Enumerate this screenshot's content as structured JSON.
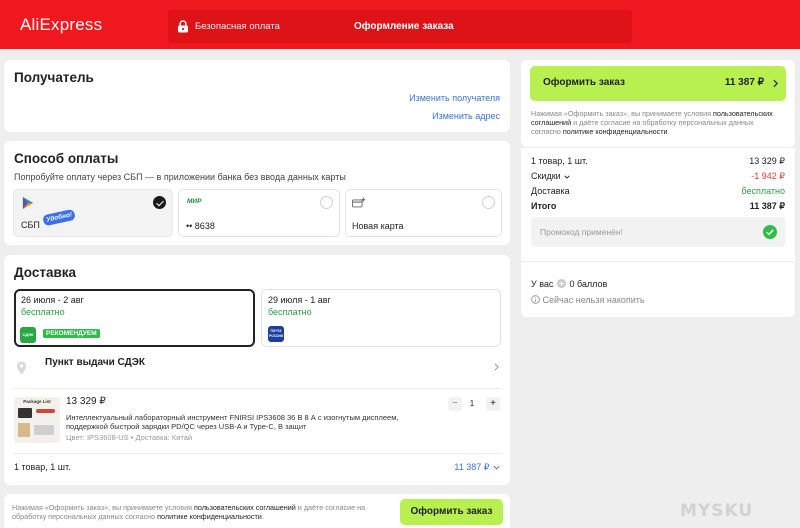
{
  "header": {
    "logo": "AliExpress",
    "secure_label": "Безопасная оплата",
    "title": "Оформление заказа"
  },
  "recipient": {
    "title": "Получатель",
    "change_recipient": "Изменить получателя",
    "change_address": "Изменить адрес"
  },
  "payment": {
    "title": "Способ оплаты",
    "subtitle": "Попробуйте оплату через СБП — в приложении банка без ввода данных карты",
    "options": [
      {
        "label": "СБП",
        "badge": "Удобно!",
        "selected": true
      },
      {
        "brand": "МИР",
        "label": "•• 8638",
        "selected": false
      },
      {
        "label": "Новая карта",
        "selected": false
      }
    ]
  },
  "delivery": {
    "title": "Доставка",
    "options": [
      {
        "dates": "26 июля - 2 авг",
        "price": "бесплатно",
        "carrier": "СДЭК",
        "badge": "РЕКОМЕНДУЕМ",
        "selected": true
      },
      {
        "dates": "29 июля - 1 авг",
        "price": "бесплатно",
        "carrier": "ПОЧТА РОССИИ",
        "selected": false
      }
    ],
    "pickup": "Пункт выдачи СДЭК"
  },
  "product": {
    "price": "13 329 ₽",
    "name_line1": "Интеллектуальный лабораторный инструмент FNIRSI IPS3608 36 В 8 А с изогнутым дисплеем,",
    "name_line2": "поддержкой быстрой зарядки PD/QC через USB-A и Type-C, В защит",
    "meta": "Цвет: IPS3608-US • Доставка: Китай",
    "image_caption": "Package List",
    "quantity": "1",
    "minus": "−",
    "plus": "+"
  },
  "items_footer": {
    "count": "1 товар, 1 шт.",
    "total": "11 387 ₽"
  },
  "bottom_bar": {
    "text_part1": "Нажимая «Оформить заказ», вы принимаете условия ",
    "text_link1": "пользовательских соглашений",
    "text_part2": " и даёте согласие на",
    "text_part3": "обработку персональных данных согласно ",
    "text_link2": "политике конфиденциальности",
    "text_part4": ".",
    "button": "Оформить заказ"
  },
  "summary": {
    "button_label": "Оформить заказ",
    "button_total": "11 387 ₽",
    "terms_part1": "Нажимая «Оформить заказ», вы принимаете условия ",
    "terms_link1": "пользовательских",
    "terms_link1b": "соглашений",
    "terms_part2": " и даёте согласие на обработку персональных данных",
    "terms_part3": "согласно ",
    "terms_link2": "политике конфиденциальности",
    "terms_part4": ".",
    "rows": [
      {
        "label": "1 товар, 1 шт.",
        "value": "13 329 ₽"
      },
      {
        "label": "Скидки",
        "value": "-1 942 ₽"
      },
      {
        "label": "Доставка",
        "value": "бесплатно"
      },
      {
        "label": "Итого",
        "value": "11 387 ₽"
      }
    ],
    "promo": "Промокод применён!",
    "points_prefix": "У вас",
    "points_value": "0 баллов",
    "points_note": "Сейчас нельзя накопить"
  },
  "watermark": "MYSKU",
  "colors": {
    "brand_red": "#f0181e",
    "accent_green": "#b8f04f",
    "link_blue": "#3a73d8",
    "discount_red": "#e53935",
    "free_green": "#2ea043"
  }
}
